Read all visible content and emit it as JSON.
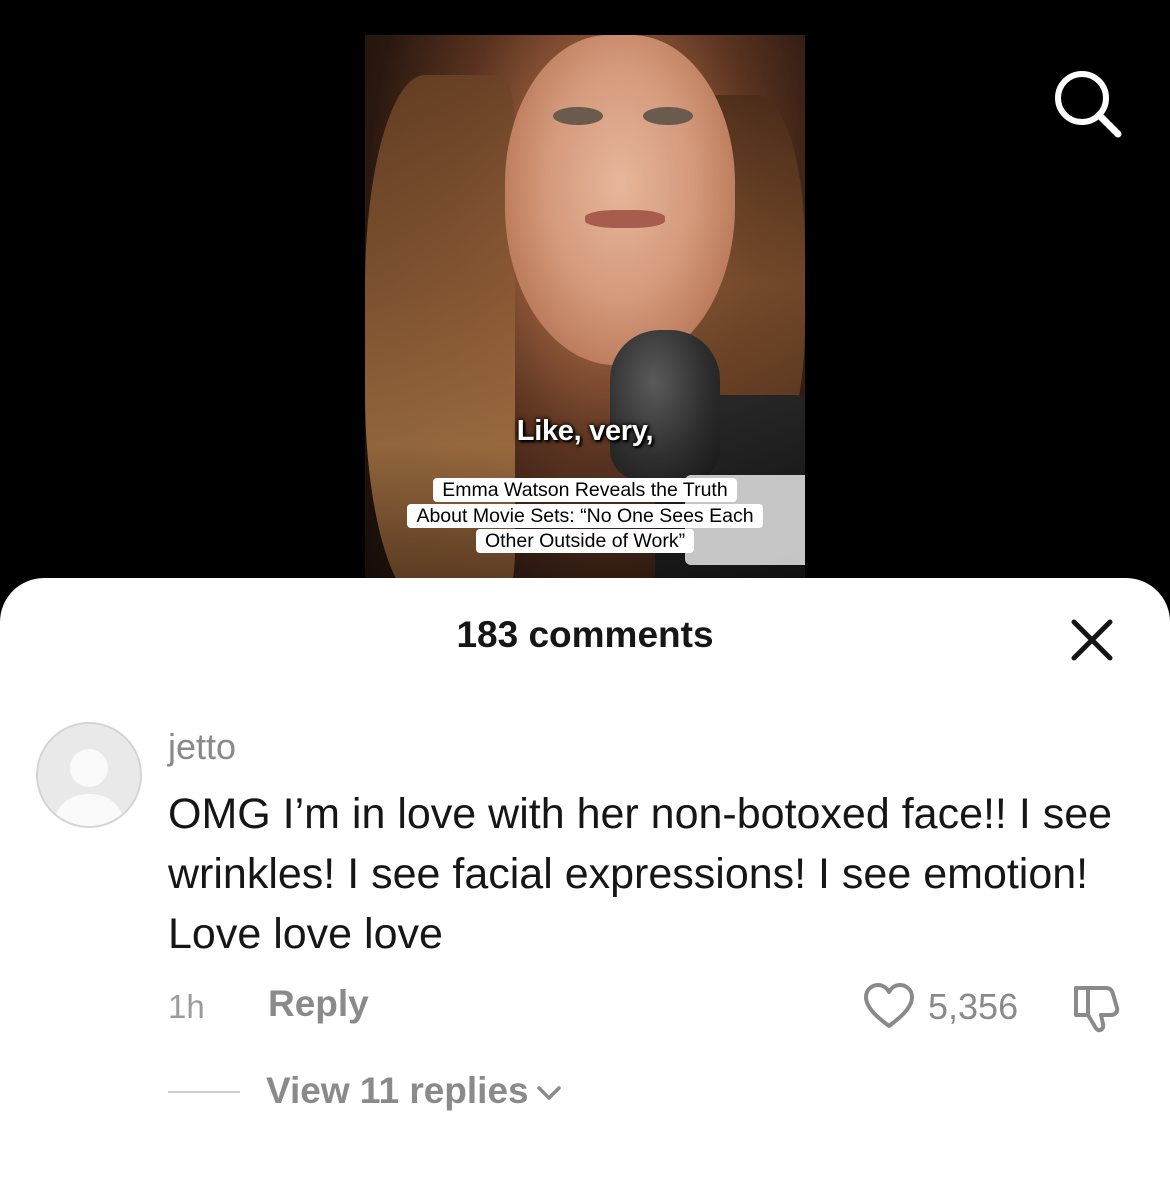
{
  "video": {
    "subtitle": "Like, very,",
    "caption_lines": [
      "Emma Watson Reveals the Truth",
      "About Movie Sets: “No One Sees Each",
      "Other Outside of Work”"
    ]
  },
  "header": {
    "search_icon": "search-icon"
  },
  "comments_sheet": {
    "title": "183 comments",
    "close_icon": "close-icon",
    "comment": {
      "username": "jetto",
      "text": "OMG I’m in love with her non-botoxed face!! I see wrinkles! I see facial expressions! I see emotion! Love love love",
      "time": "1h",
      "reply_label": "Reply",
      "like_count": "5,356",
      "like_icon": "heart-outline-icon",
      "dislike_icon": "thumbs-down-icon",
      "view_replies_label": "View 11 replies",
      "view_replies_icon": "chevron-down-icon"
    }
  }
}
